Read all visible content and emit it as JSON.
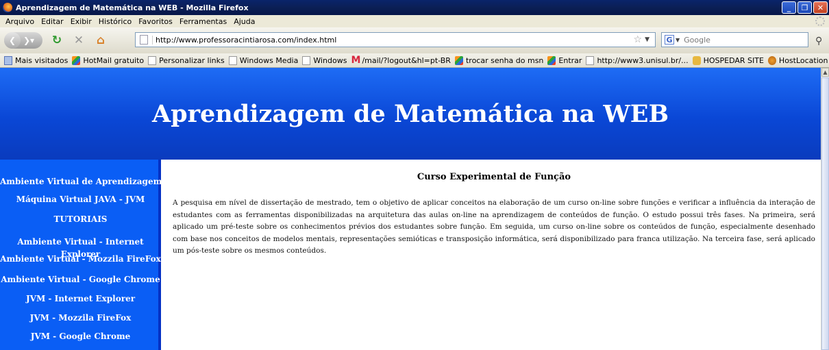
{
  "window": {
    "title": "Aprendizagem de Matemática na WEB - Mozilla Firefox",
    "minimize": "_",
    "maximize": "❐",
    "close": "✕"
  },
  "menu": [
    "Arquivo",
    "Editar",
    "Exibir",
    "Histórico",
    "Favoritos",
    "Ferramentas",
    "Ajuda"
  ],
  "toolbar": {
    "url": "http://www.professoracintiarosa.com/index.html",
    "search_engine": "G",
    "search_placeholder": "Google"
  },
  "bookmarks": [
    {
      "label": "Mais visitados",
      "icon": "most-visited-icon"
    },
    {
      "label": "HotMail gratuito",
      "icon": "msn-icon"
    },
    {
      "label": "Personalizar links",
      "icon": "page-icon"
    },
    {
      "label": "Windows Media",
      "icon": "page-icon"
    },
    {
      "label": "Windows",
      "icon": "page-icon"
    },
    {
      "label": "/mail/?logout&hl=pt-BR",
      "icon": "gmail-icon"
    },
    {
      "label": "trocar senha do msn",
      "icon": "msn-icon"
    },
    {
      "label": "Entrar",
      "icon": "msn-icon"
    },
    {
      "label": "http://www3.unisul.br/...",
      "icon": "page-icon"
    },
    {
      "label": "HOSPEDAR SITE",
      "icon": "lock-icon"
    },
    {
      "label": "HostLocation",
      "icon": "shield-icon"
    }
  ],
  "page": {
    "heading": "Aprendizagem de Matemática na WEB",
    "nav": [
      "Ambiente Virtual de Aprendizagem",
      "Máquina Virtual JAVA - JVM",
      "TUTORIAIS",
      "Ambiente Virtual - Internet Explorer",
      "Ambiente Virtual - Mozzila FireFox",
      "Ambiente Virtual - Google Chrome",
      "JVM - Internet Explorer",
      "JVM - Mozzila FireFox",
      "JVM - Google Chrome"
    ],
    "course_title": "Curso Experimental de Função",
    "course_text": "A pesquisa em nível de dissertação de mestrado, tem o objetivo de aplicar conceitos na elaboração de um curso on-line sobre funções e verificar a influência da interação de estudantes com as ferramentas disponibilizadas na arquitetura das aulas on-line na aprendizagem de conteúdos de função. O estudo possui três fases. Na primeira, será aplicado um pré-teste sobre os conhecimentos prévios dos estudantes sobre função. Em seguida, um curso on-line sobre os conteúdos de função, especialmente desenhado com base nos conceitos de modelos mentais, representações semióticas e transposição informática, será disponibilizado para franca utilização. Na terceira fase, será aplicado um pós-teste sobre os mesmos conteúdos."
  },
  "colors": {
    "header_blue": "#0a47d6",
    "sidebar_blue": "#0a5ef5",
    "title_bar": "#0a246a"
  }
}
